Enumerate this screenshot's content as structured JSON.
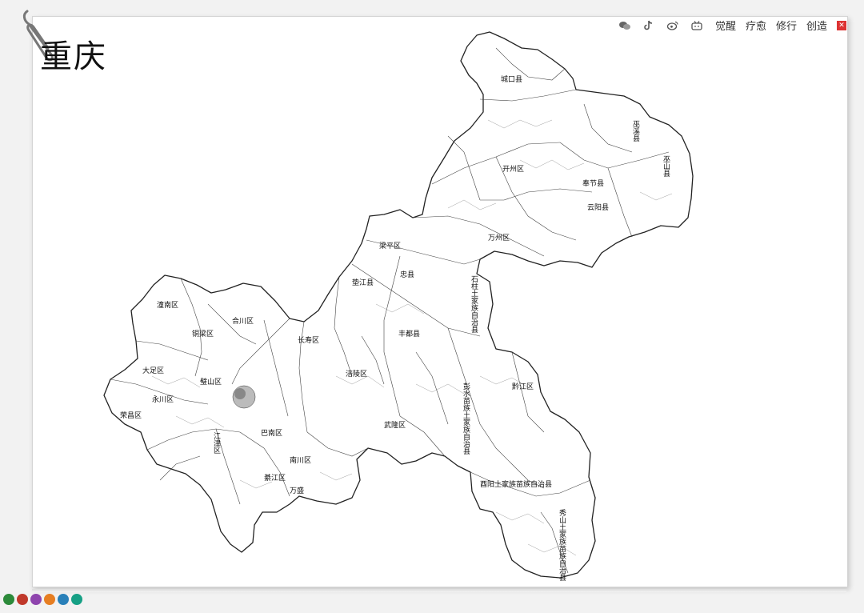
{
  "header": {
    "title": "重庆",
    "nav": [
      {
        "icon": "wechat-icon",
        "label": ""
      },
      {
        "icon": "tiktok-icon",
        "label": ""
      },
      {
        "icon": "weibo-icon",
        "label": ""
      },
      {
        "icon": "bilibili-icon",
        "label": ""
      },
      {
        "label": "觉醒"
      },
      {
        "label": "疗愈"
      },
      {
        "label": "修行"
      },
      {
        "label": "创造"
      }
    ]
  },
  "map": {
    "region": "重庆",
    "labels": [
      {
        "name": "城口县",
        "orient": "h"
      },
      {
        "name": "巫山县",
        "orient": "v"
      },
      {
        "name": "巫溪县",
        "orient": "v"
      },
      {
        "name": "奉节县",
        "orient": "h"
      },
      {
        "name": "云阳县",
        "orient": "h"
      },
      {
        "name": "开州区",
        "orient": "h"
      },
      {
        "name": "万州区",
        "orient": "h"
      },
      {
        "name": "梁平区",
        "orient": "h"
      },
      {
        "name": "忠县",
        "orient": "h"
      },
      {
        "name": "垫江县",
        "orient": "h"
      },
      {
        "name": "石柱土家族自治县",
        "orient": "v"
      },
      {
        "name": "丰都县",
        "orient": "h"
      },
      {
        "name": "涪陵区",
        "orient": "h"
      },
      {
        "name": "长寿区",
        "orient": "h"
      },
      {
        "name": "武隆区",
        "orient": "h"
      },
      {
        "name": "彭水苗族土家族自治县",
        "orient": "v"
      },
      {
        "name": "黔江区",
        "orient": "h"
      },
      {
        "name": "酉阳土家族苗族自治县",
        "orient": "h"
      },
      {
        "name": "秀山土家族苗族自治县",
        "orient": "v"
      },
      {
        "name": "南川区",
        "orient": "h"
      },
      {
        "name": "巴南区",
        "orient": "h"
      },
      {
        "name": "綦江区",
        "orient": "h"
      },
      {
        "name": "江津区",
        "orient": "v"
      },
      {
        "name": "永川区",
        "orient": "h"
      },
      {
        "name": "荣昌区",
        "orient": "h"
      },
      {
        "name": "大足区",
        "orient": "h"
      },
      {
        "name": "潼南区",
        "orient": "h"
      },
      {
        "name": "铜梁区",
        "orient": "h"
      },
      {
        "name": "合川区",
        "orient": "h"
      },
      {
        "name": "璧山区",
        "orient": "h"
      },
      {
        "name": "万盛",
        "orient": "h"
      }
    ]
  },
  "footer": {
    "badges": [
      "#2c8a3a",
      "#c0392b",
      "#8e44ad",
      "#e67e22",
      "#2980b9",
      "#16a085"
    ]
  }
}
